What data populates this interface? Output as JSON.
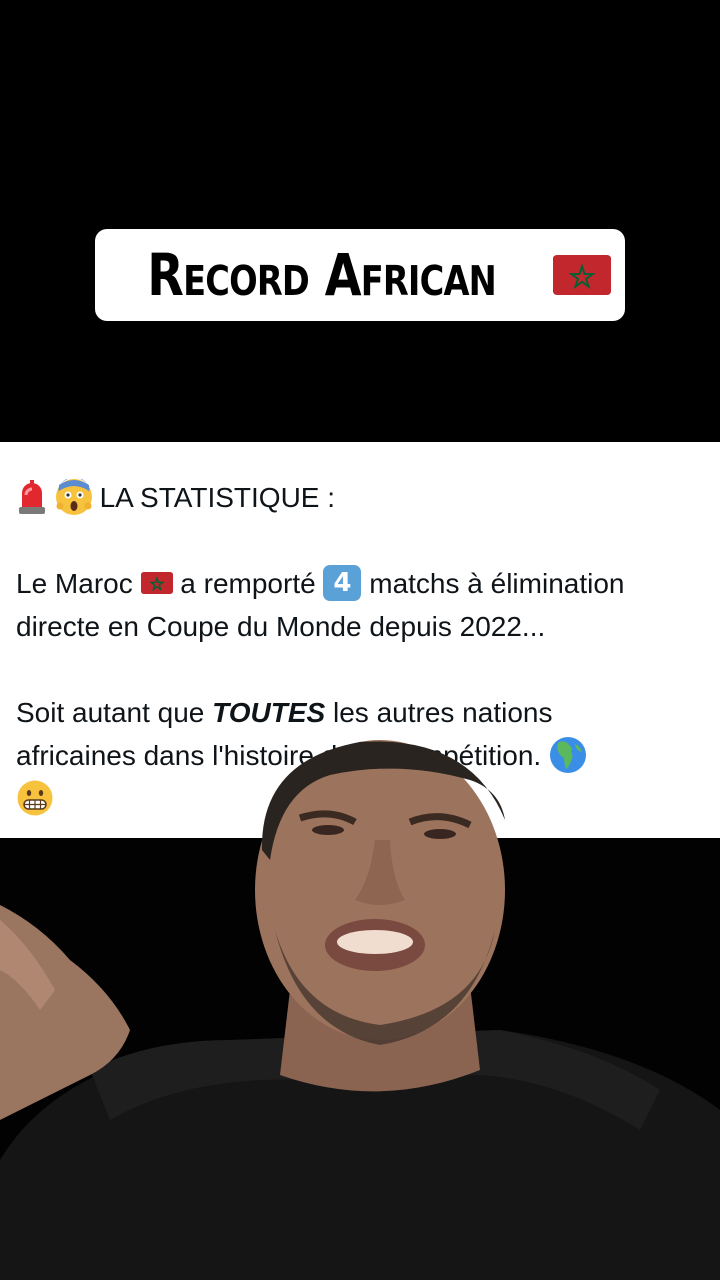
{
  "title": {
    "text": "Record African",
    "flag_icon": "morocco-flag-icon"
  },
  "tweet": {
    "line1": {
      "emojis": [
        "police-light-icon",
        "scream-face-icon"
      ],
      "text": "LA STATISTIQUE :"
    },
    "line2": {
      "part1": "Le Maroc",
      "flag_icon": "morocco-flag-icon",
      "part2": "a remporté",
      "keycap": "4",
      "part3": "matchs à élimination"
    },
    "line3": "directe en Coupe du Monde depuis 2022...",
    "line4": {
      "part1": "Soit autant que",
      "emphasis": "TOUTES",
      "part2": "les autres nations"
    },
    "line5": {
      "text": "africaines dans l'histoire de la compétition.",
      "emoji": "globe-africa-icon"
    },
    "line6": {
      "emoji": "grimacing-face-icon"
    }
  },
  "colors": {
    "flag_red": "#c1272d",
    "flag_green": "#006233",
    "tweet_text": "#0f1419",
    "background": "#000000"
  }
}
